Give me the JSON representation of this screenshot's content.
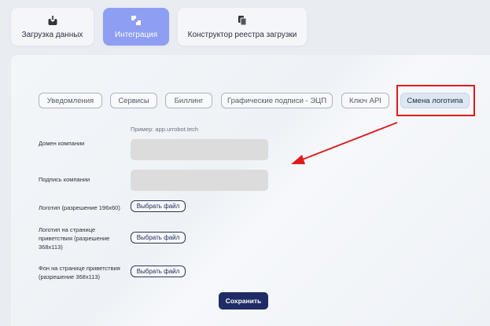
{
  "top_tabs": [
    {
      "label": "Загрузка данных",
      "icon": "download-box-icon"
    },
    {
      "label": "Интеграция",
      "icon": "puzzle-blocks-icon",
      "active": true
    },
    {
      "label": "Конструктор реестра загрузки",
      "icon": "documents-icon"
    }
  ],
  "sub_tabs": [
    {
      "label": "Уведомления"
    },
    {
      "label": "Сервисы"
    },
    {
      "label": "Биллинг"
    },
    {
      "label": "Графические подписи - ЭЦП"
    },
    {
      "label": "Ключ API"
    },
    {
      "label": "Смена логотипа",
      "active": true
    }
  ],
  "form": {
    "domain_hint": "Пример: app.urrobot.tech",
    "domain_label": "Домен компании",
    "domain_value": "",
    "signature_label": "Подпись компании",
    "signature_value": "",
    "logo_label": "Логотип (разрешение 196x60)",
    "logo_welcome_label_1": "Логотип на странице",
    "logo_welcome_label_2": "приветствия (разрешение",
    "logo_welcome_label_3": "368x113)",
    "bg_welcome_label_1": "Фон на странице приветствия",
    "bg_welcome_label_2": "(разрешение 368x113)",
    "choose_file_label": "Выбрать файл",
    "save_label": "Сохранить"
  },
  "colors": {
    "accent": "#8e9ef3",
    "primary_button": "#1f2c66",
    "annotation_red": "#e01b1b"
  }
}
